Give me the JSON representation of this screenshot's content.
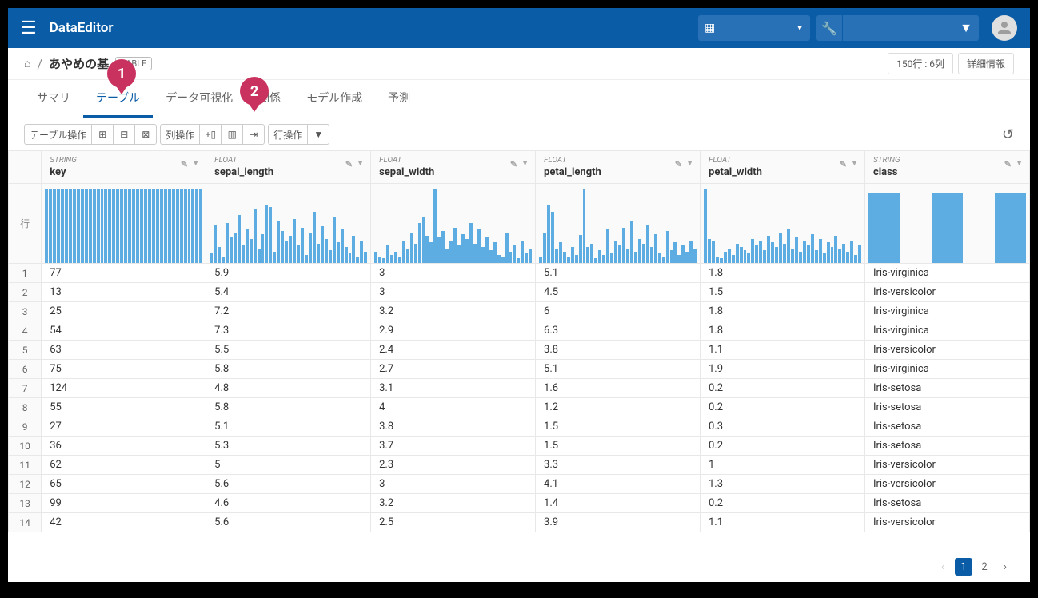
{
  "header": {
    "app_title": "DataEditor"
  },
  "breadcrumb": {
    "title": "あやめの基",
    "badge": "TABLE",
    "info": "150行 : 6列",
    "detail": "詳細情報"
  },
  "tabs": [
    "サマリ",
    "テーブル",
    "データ可視化",
    "関係",
    "モデル作成",
    "予測"
  ],
  "active_tab": 1,
  "callouts": {
    "c1": "1",
    "c2": "2"
  },
  "toolbar": {
    "table_ops": "テーブル操作",
    "col_ops": "列操作",
    "row_ops": "行操作"
  },
  "row_header": "行",
  "columns": [
    {
      "type": "STRING",
      "name": "key"
    },
    {
      "type": "FLOAT",
      "name": "sepal_length"
    },
    {
      "type": "FLOAT",
      "name": "sepal_width"
    },
    {
      "type": "FLOAT",
      "name": "petal_length"
    },
    {
      "type": "FLOAT",
      "name": "petal_width"
    },
    {
      "type": "STRING",
      "name": "class"
    }
  ],
  "histograms": [
    [
      92,
      92,
      92,
      92,
      92,
      92,
      92,
      92,
      92,
      92,
      92,
      92,
      92,
      92,
      92,
      92,
      92,
      92,
      92,
      92,
      92,
      92,
      92,
      92,
      92,
      92,
      92,
      92,
      92,
      92,
      92,
      92,
      92,
      92,
      92,
      92,
      92,
      92,
      92,
      92
    ],
    [
      12,
      48,
      20,
      8,
      50,
      32,
      38,
      60,
      22,
      42,
      30,
      68,
      18,
      36,
      72,
      70,
      14,
      52,
      40,
      28,
      34,
      55,
      22,
      44,
      10,
      38,
      64,
      24,
      46,
      30,
      16,
      58,
      26,
      42,
      20,
      12,
      34,
      8,
      28,
      14
    ],
    [
      14,
      8,
      6,
      22,
      10,
      14,
      8,
      28,
      18,
      38,
      24,
      50,
      58,
      34,
      26,
      92,
      32,
      40,
      18,
      28,
      44,
      22,
      36,
      30,
      50,
      24,
      42,
      20,
      32,
      16,
      26,
      10,
      8,
      38,
      14,
      22,
      6,
      28,
      12,
      18
    ],
    [
      8,
      38,
      72,
      64,
      18,
      26,
      14,
      8,
      20,
      10,
      35,
      92,
      20,
      24,
      6,
      16,
      10,
      42,
      12,
      28,
      22,
      44,
      18,
      52,
      14,
      30,
      24,
      48,
      20,
      36,
      12,
      8,
      40,
      16,
      26,
      10,
      22,
      14,
      28,
      18
    ],
    [
      92,
      30,
      28,
      8,
      6,
      14,
      18,
      10,
      24,
      20,
      16,
      12,
      30,
      22,
      28,
      16,
      34,
      26,
      20,
      38,
      24,
      42,
      18,
      32,
      14,
      28,
      22,
      36,
      16,
      30,
      12,
      26,
      20,
      34,
      18,
      24,
      14,
      28,
      10,
      22
    ],
    [
      88,
      0,
      88,
      0,
      88
    ]
  ],
  "rows": [
    {
      "n": "1",
      "c": [
        "77",
        "5.9",
        "3",
        "5.1",
        "1.8",
        "Iris-virginica"
      ]
    },
    {
      "n": "2",
      "c": [
        "13",
        "5.4",
        "3",
        "4.5",
        "1.5",
        "Iris-versicolor"
      ]
    },
    {
      "n": "3",
      "c": [
        "25",
        "7.2",
        "3.2",
        "6",
        "1.8",
        "Iris-virginica"
      ]
    },
    {
      "n": "4",
      "c": [
        "54",
        "7.3",
        "2.9",
        "6.3",
        "1.8",
        "Iris-virginica"
      ]
    },
    {
      "n": "5",
      "c": [
        "63",
        "5.5",
        "2.4",
        "3.8",
        "1.1",
        "Iris-versicolor"
      ]
    },
    {
      "n": "6",
      "c": [
        "75",
        "5.8",
        "2.7",
        "5.1",
        "1.9",
        "Iris-virginica"
      ]
    },
    {
      "n": "7",
      "c": [
        "124",
        "4.8",
        "3.1",
        "1.6",
        "0.2",
        "Iris-setosa"
      ]
    },
    {
      "n": "8",
      "c": [
        "55",
        "5.8",
        "4",
        "1.2",
        "0.2",
        "Iris-setosa"
      ]
    },
    {
      "n": "9",
      "c": [
        "27",
        "5.1",
        "3.8",
        "1.5",
        "0.3",
        "Iris-setosa"
      ]
    },
    {
      "n": "10",
      "c": [
        "36",
        "5.3",
        "3.7",
        "1.5",
        "0.2",
        "Iris-setosa"
      ]
    },
    {
      "n": "11",
      "c": [
        "62",
        "5",
        "2.3",
        "3.3",
        "1",
        "Iris-versicolor"
      ]
    },
    {
      "n": "12",
      "c": [
        "65",
        "5.6",
        "3",
        "4.1",
        "1.3",
        "Iris-versicolor"
      ]
    },
    {
      "n": "13",
      "c": [
        "99",
        "4.6",
        "3.2",
        "1.4",
        "0.2",
        "Iris-setosa"
      ]
    },
    {
      "n": "14",
      "c": [
        "42",
        "5.6",
        "2.5",
        "3.9",
        "1.1",
        "Iris-versicolor"
      ]
    }
  ],
  "pagination": {
    "current": "1",
    "next": "2"
  }
}
